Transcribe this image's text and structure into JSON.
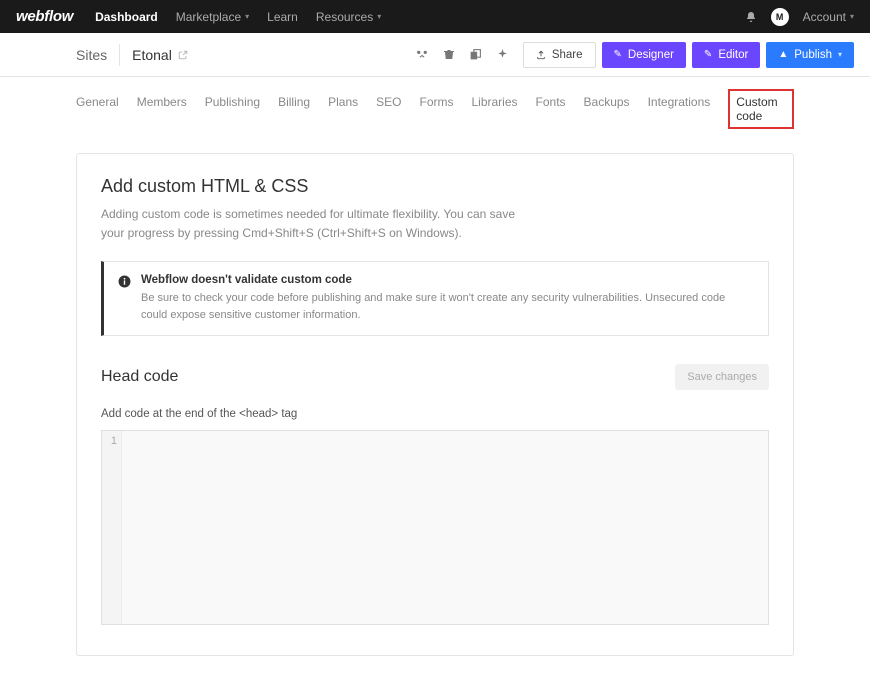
{
  "top": {
    "logo": "webflow",
    "nav": [
      "Dashboard",
      "Marketplace",
      "Learn",
      "Resources"
    ],
    "account_initial": "M",
    "account_label": "Account"
  },
  "subbar": {
    "sites": "Sites",
    "site_name": "Etonal",
    "share": "Share",
    "designer": "Designer",
    "editor": "Editor",
    "publish": "Publish"
  },
  "tabs": [
    "General",
    "Members",
    "Publishing",
    "Billing",
    "Plans",
    "SEO",
    "Forms",
    "Libraries",
    "Fonts",
    "Backups",
    "Integrations",
    "Custom code"
  ],
  "panel": {
    "title": "Add custom HTML & CSS",
    "subtitle": "Adding custom code is sometimes needed for ultimate flexibility. You can save your progress by pressing Cmd+Shift+S (Ctrl+Shift+S on Windows).",
    "alert_title": "Webflow doesn't validate custom code",
    "alert_body": "Be sure to check your code before publishing and make sure it won't create any security vulnerabilities. Unsecured code could expose sensitive customer information."
  },
  "head": {
    "title": "Head code",
    "save": "Save changes",
    "hint": "Add code at the end of the <head> tag",
    "line1": "1"
  }
}
